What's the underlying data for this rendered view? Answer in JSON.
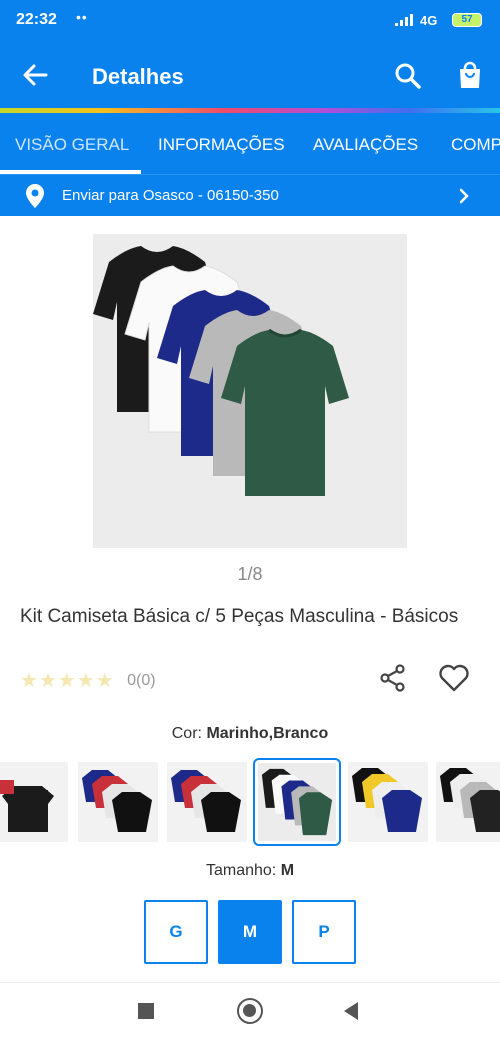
{
  "status_bar": {
    "time": "22:32",
    "dots": "••",
    "network": "4G",
    "battery": "57"
  },
  "app_bar": {
    "title": "Detalhes"
  },
  "tabs": [
    {
      "label": "VISÃO GERAL"
    },
    {
      "label": "INFORMAÇÕES"
    },
    {
      "label": "AVALIAÇÕES"
    },
    {
      "label": "COMP"
    }
  ],
  "shipping": {
    "text": "Enviar para Osasco - 06150-350"
  },
  "gallery": {
    "pager": "1/8"
  },
  "product": {
    "title": "Kit Camiseta Básica c/ 5 Peças Masculina - Básicos",
    "rating_stars": 0,
    "rating_count": "0(0)"
  },
  "color": {
    "label": "Cor:",
    "value": "Marinho,Branco"
  },
  "size": {
    "label": "Tamanho:",
    "value": "M",
    "options": [
      "G",
      "M",
      "P"
    ]
  },
  "colors": {
    "primary": "#0a82ee",
    "star_empty": "#f4e7b0",
    "shirt_green": "#2f5a45",
    "shirt_navy": "#1d2a8a"
  }
}
